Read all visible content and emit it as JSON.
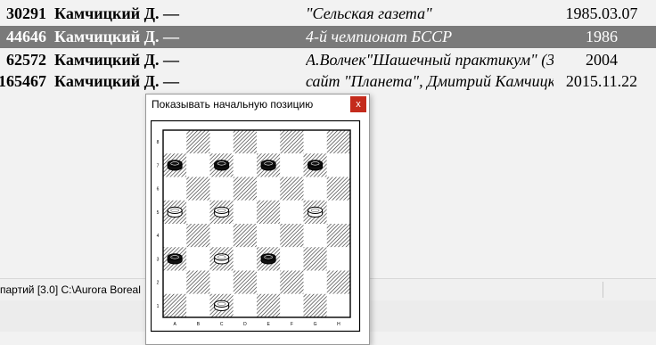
{
  "games": [
    {
      "id": "30291",
      "player": "Камчицкий Д. —",
      "source": "\"Сельская газета\"",
      "date": "1985.03.07",
      "selected": false
    },
    {
      "id": "44646",
      "player": "Камчицкий Д. —",
      "source": "4-й чемпионат БССР",
      "date": "1986",
      "selected": true
    },
    {
      "id": "62572",
      "player": "Камчицкий Д. —",
      "source": "А.Волчек\"Шашечный практикум\" (3",
      "date": "2004",
      "selected": false
    },
    {
      "id": "165467",
      "player": "Камчицкий Д. —",
      "source": "сайт \"Планета\", Дмитрий Камчицк",
      "date": "2015.11.22",
      "selected": false
    }
  ],
  "statusbar": {
    "text": "а партий [3.0] C:\\Aurora Boreal"
  },
  "dialog": {
    "title": "Показывать начальную позицию",
    "close_glyph": "x"
  },
  "board": {
    "files": [
      "A",
      "B",
      "C",
      "D",
      "E",
      "F",
      "G",
      "H"
    ],
    "ranks": [
      "8",
      "7",
      "6",
      "5",
      "4",
      "3",
      "2",
      "1"
    ],
    "pieces": [
      {
        "color": "black",
        "square": "a7"
      },
      {
        "color": "black",
        "square": "c7"
      },
      {
        "color": "black",
        "square": "e7"
      },
      {
        "color": "black",
        "square": "g7"
      },
      {
        "color": "white",
        "square": "a5"
      },
      {
        "color": "white",
        "square": "c5"
      },
      {
        "color": "white",
        "square": "g5"
      },
      {
        "color": "black",
        "square": "a3"
      },
      {
        "color": "white",
        "square": "c3"
      },
      {
        "color": "black",
        "square": "e3"
      },
      {
        "color": "white",
        "square": "c1"
      }
    ]
  }
}
